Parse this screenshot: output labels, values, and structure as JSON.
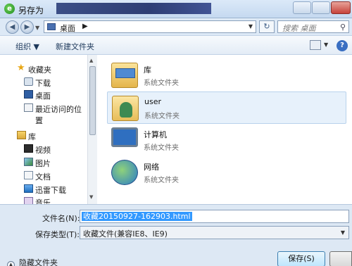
{
  "window": {
    "title": "另存为"
  },
  "address": {
    "location": "桌面",
    "search_placeholder": "搜索 桌面"
  },
  "toolbar": {
    "organize": "组织 ▼",
    "new_folder": "新建文件夹"
  },
  "sidebar": {
    "favorites": {
      "label": "收藏夹",
      "items": [
        {
          "label": "下载",
          "icon": "download-icon"
        },
        {
          "label": "桌面",
          "icon": "desktop-icon"
        },
        {
          "label": "最近访问的位置",
          "icon": "recent-places-icon"
        }
      ]
    },
    "libraries": {
      "label": "库",
      "items": [
        {
          "label": "视频",
          "icon": "video-icon"
        },
        {
          "label": "图片",
          "icon": "pictures-icon"
        },
        {
          "label": "文档",
          "icon": "documents-icon"
        },
        {
          "label": "迅雷下载",
          "icon": "thunder-download-icon"
        },
        {
          "label": "音乐",
          "icon": "music-icon"
        }
      ]
    }
  },
  "files": [
    {
      "name": "库",
      "type": "系统文件夹",
      "icon": "library-folder-icon"
    },
    {
      "name": "user",
      "type": "系统文件夹",
      "icon": "user-folder-icon"
    },
    {
      "name": "计算机",
      "type": "系统文件夹",
      "icon": "computer-icon"
    },
    {
      "name": "网络",
      "type": "系统文件夹",
      "icon": "network-icon"
    }
  ],
  "form": {
    "filename_label": "文件名(N):",
    "filename_value": "收藏20150927-162903.html",
    "filetype_label": "保存类型(T):",
    "filetype_value": "收藏文件(兼容IE8、IE9)",
    "hide_folders": "隐藏文件夹",
    "save": "保存(S)"
  }
}
